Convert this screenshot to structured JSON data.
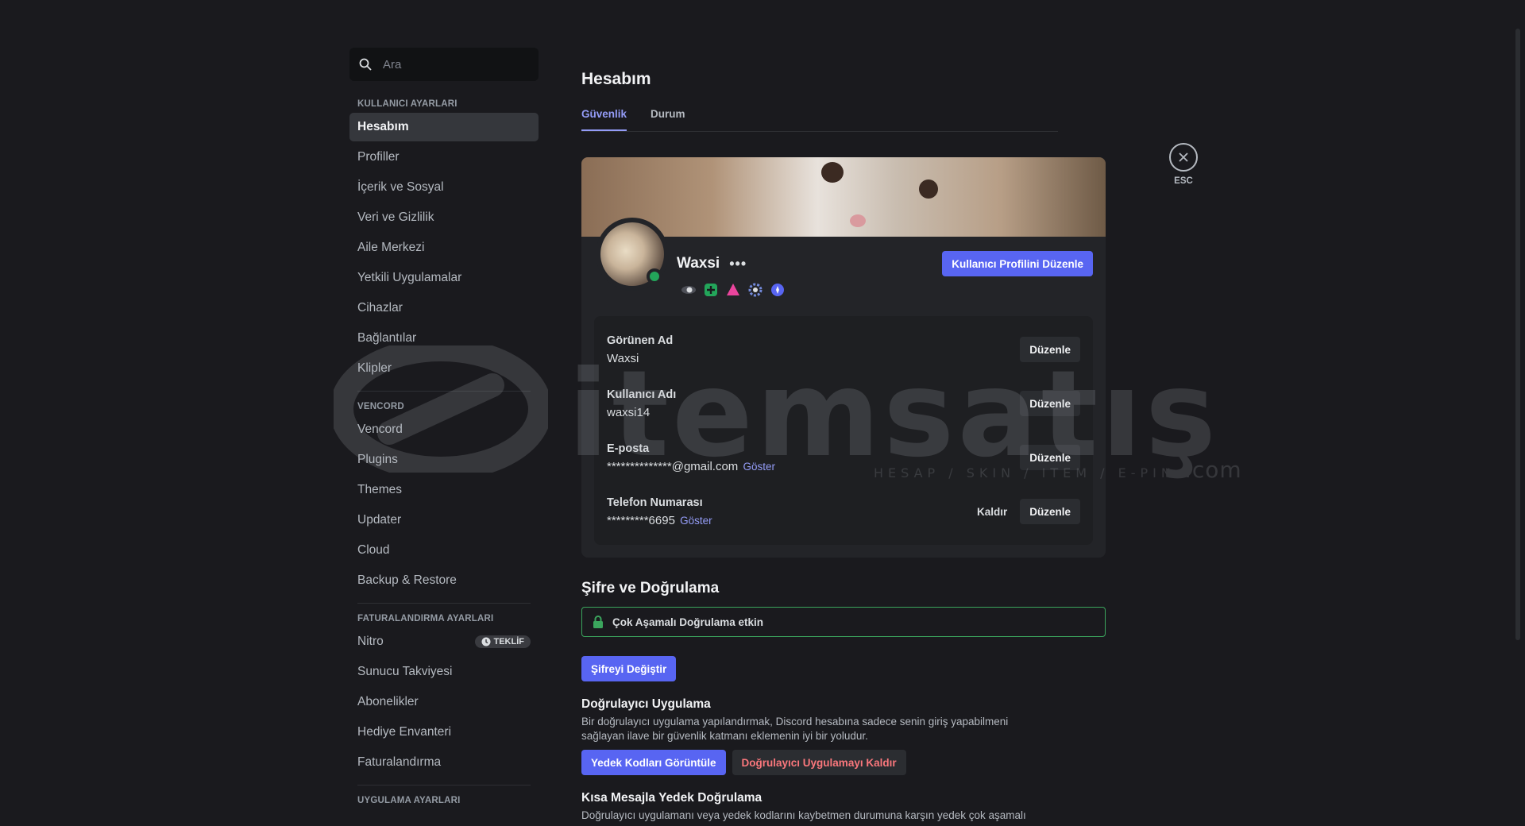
{
  "window": {
    "minimize": "—",
    "maximize": "☐",
    "close": "✕"
  },
  "search": {
    "placeholder": "Ara"
  },
  "sidebar": {
    "user_settings_header": "KULLANICI AYARLARI",
    "user_items": [
      "Hesabım",
      "Profiller",
      "İçerik ve Sosyal",
      "Veri ve Gizlilik",
      "Aile Merkezi",
      "Yetkili Uygulamalar",
      "Cihazlar",
      "Bağlantılar",
      "Klipler"
    ],
    "vencord_header": "VENCORD",
    "vencord_items": [
      "Vencord",
      "Plugins",
      "Themes",
      "Updater",
      "Cloud",
      "Backup & Restore"
    ],
    "billing_header": "FATURALANDIRMA AYARLARI",
    "billing_items": [
      "Nitro",
      "Sunucu Takviyesi",
      "Abonelikler",
      "Hediye Envanteri",
      "Faturalandırma"
    ],
    "nitro_badge": "TEKLİF",
    "app_settings_header": "UYGULAMA AYARLARI"
  },
  "page": {
    "title": "Hesabım",
    "tabs": [
      "Güvenlik",
      "Durum"
    ],
    "esc_label": "ESC"
  },
  "profile": {
    "username": "Waxsi",
    "more": "•••",
    "edit_profile_button": "Kullanıcı Profilini Düzenle",
    "status_color": "#23a55a",
    "fields": [
      {
        "label": "Görünen Ad",
        "value": "Waxsi",
        "show": "",
        "remove": "",
        "edit": "Düzenle"
      },
      {
        "label": "Kullanıcı Adı",
        "value": "waxsi14",
        "show": "",
        "remove": "",
        "edit": "Düzenle"
      },
      {
        "label": "E-posta",
        "value": "**************@gmail.com",
        "show": "Göster",
        "remove": "",
        "edit": "Düzenle"
      },
      {
        "label": "Telefon Numarası",
        "value": "*********6695",
        "show": "Göster",
        "remove": "Kaldır",
        "edit": "Düzenle"
      }
    ]
  },
  "security": {
    "title": "Şifre ve Doğrulama",
    "mfa_status": "Çok Aşamalı Doğrulama etkin",
    "change_password": "Şifreyi Değiştir",
    "authenticator_title": "Doğrulayıcı Uygulama",
    "authenticator_desc": "Bir doğrulayıcı uygulama yapılandırmak, Discord hesabına sadece senin giriş yapabilmeni sağlayan ilave bir güvenlik katmanı eklemenin iyi bir yoludur.",
    "view_backup_codes": "Yedek Kodları Görüntüle",
    "remove_authenticator": "Doğrulayıcı Uygulamayı Kaldır",
    "sms_title": "Kısa Mesajla Yedek Doğrulama",
    "sms_desc": "Doğrulayıcı uygulamanı veya yedek kodlarını kaybetmen durumuna karşın yedek çok aşamalı"
  },
  "watermark": {
    "brand": "itemsatış",
    "tagline": "HESAP / SKIN / ITEM / E-PIN",
    "domain": ".com"
  },
  "colors": {
    "accent": "#5865f2",
    "link": "#949cf7",
    "success": "#3ba55d",
    "danger": "#fa777c"
  }
}
